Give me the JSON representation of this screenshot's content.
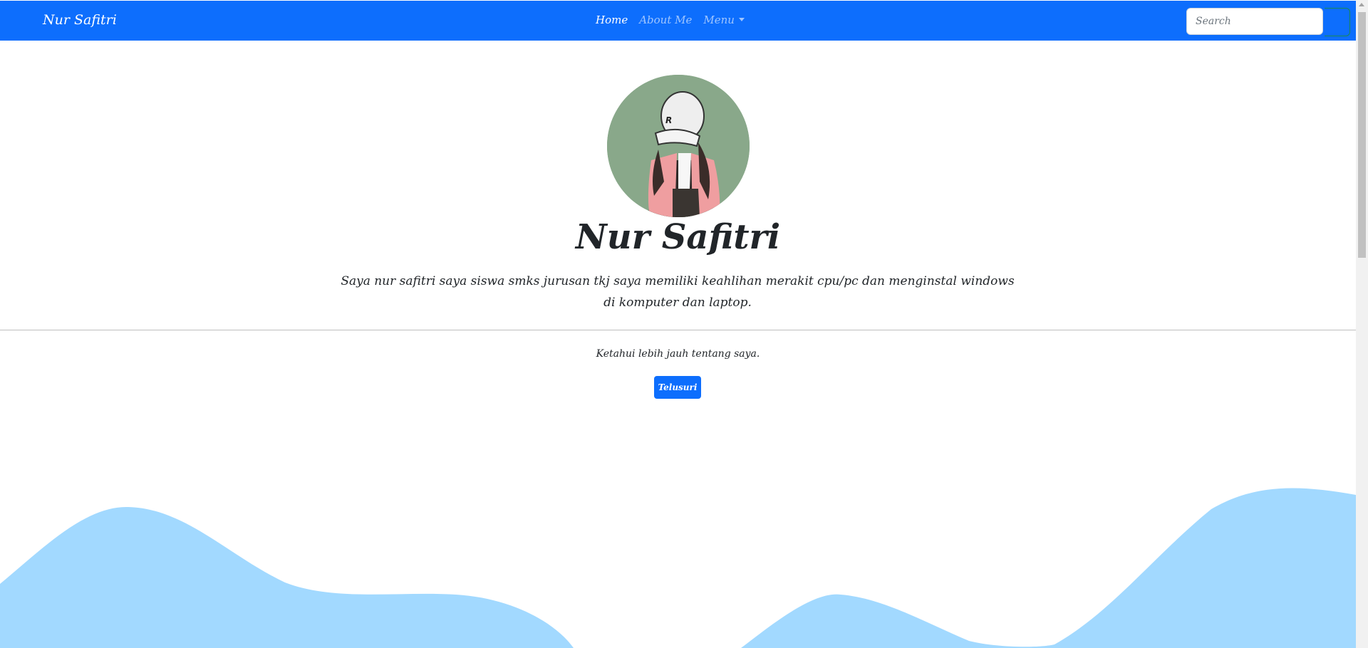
{
  "navbar": {
    "brand": "Nur Safitri",
    "links": [
      {
        "label": "Home",
        "active": true
      },
      {
        "label": "About Me",
        "active": false
      },
      {
        "label": "Menu",
        "active": false
      }
    ],
    "search": {
      "placeholder": "Search",
      "value": ""
    }
  },
  "hero": {
    "name": "Nur Safitri",
    "description": "Saya nur safitri saya siswa smks jurusan tkj saya memiliki keahlihan merakit cpu/pc dan menginstal windows di komputer dan laptop."
  },
  "cta": {
    "text": "Ketahui lebih jauh tentang saya.",
    "button_label": "Telusuri"
  },
  "colors": {
    "primary": "#0d6efd",
    "wave": "#a2d9ff",
    "avatar_bg": "#89a88a"
  }
}
